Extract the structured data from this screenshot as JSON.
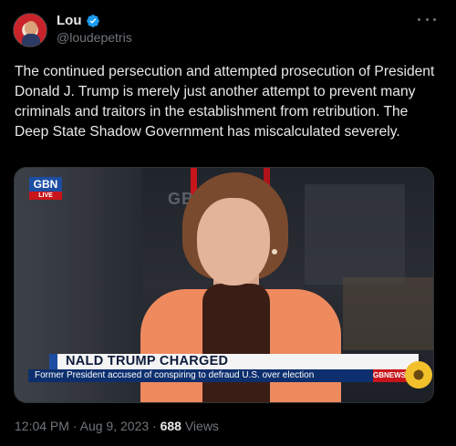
{
  "author": {
    "display_name": "Lou",
    "handle": "@loudepetris",
    "verified": true
  },
  "icons": {
    "verified": "verified-badge-icon",
    "more": "more-options-icon"
  },
  "tweet": {
    "text": "The continued persecution and attempted prosecution of President Donald J. Trump is merely just another attempt to prevent many criminals and traitors in the establishment from retribution. The Deep State Shadow Government has miscalculated severely."
  },
  "media": {
    "channel_logo": "GBN",
    "live_label": "LIVE",
    "wall_logo": "GBN",
    "headline": "NALD TRUMP CHARGED",
    "subline": "Former President accused of conspiring to defraud U.S. over election",
    "source_tag": "GBNEWS.COM"
  },
  "meta": {
    "time": "12:04 PM",
    "separator": "·",
    "date": "Aug 9, 2023",
    "views_count": "688",
    "views_label": "Views"
  },
  "colors": {
    "background": "#000000",
    "text_primary": "#e7e9ea",
    "text_secondary": "#71767b",
    "verified_blue": "#1d9bf0"
  }
}
